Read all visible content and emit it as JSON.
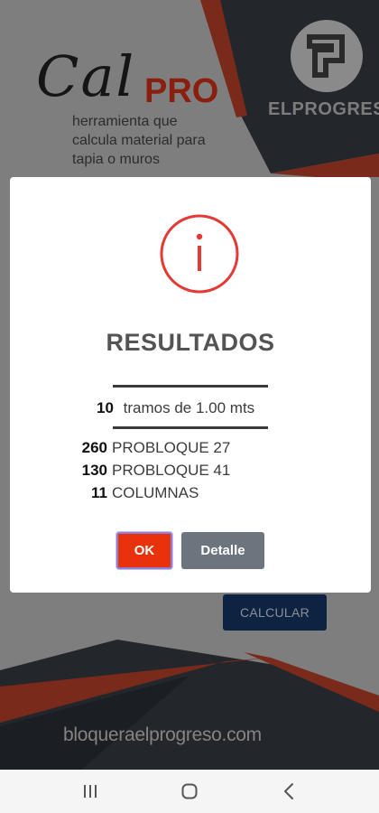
{
  "background": {
    "brand": {
      "cal_text": "Cal",
      "pro_text": "PRO",
      "tagline": "herramienta que calcula material para tapia o muros"
    },
    "company_logo": {
      "icon": "elprogreso-logo-icon",
      "name": "ELPROGRESO"
    },
    "calculate_button": {
      "label": "CALCULAR"
    },
    "website": "bloqueraelprogreso.com"
  },
  "dialog": {
    "icon": "info-icon",
    "title": "RESULTADOS",
    "segments": {
      "count": "10",
      "text": "tramos de 1.00 mts"
    },
    "materials": [
      {
        "qty": "260",
        "name": "PROBLOQUE 27"
      },
      {
        "qty": "130",
        "name": "PROBLOQUE 41"
      },
      {
        "qty": "11",
        "name": "COLUMNAS"
      }
    ],
    "ok_button": {
      "label": "OK"
    },
    "detail_button": {
      "label": "Detalle"
    }
  },
  "navbar": {
    "recents_icon": "recents-icon",
    "home_icon": "home-icon",
    "back_icon": "back-icon"
  },
  "colors": {
    "accent_red": "#e8320c",
    "icon_red": "#e53935",
    "navy": "#0e2341",
    "secondary_gray": "#6c757d",
    "dim_background": "#7e7e7e"
  }
}
